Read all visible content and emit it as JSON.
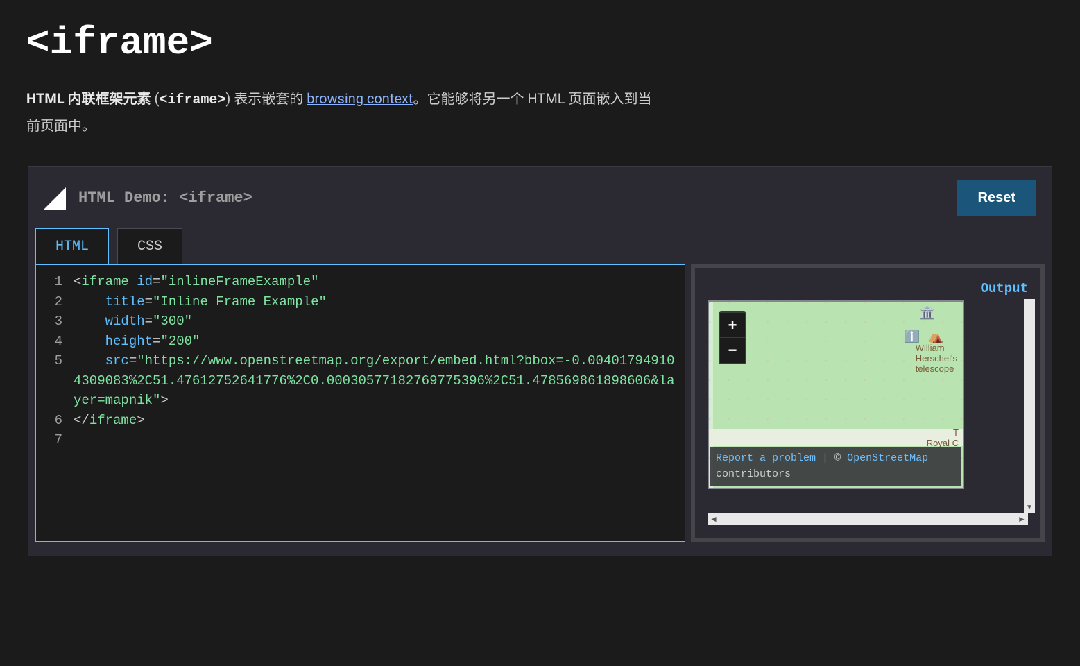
{
  "title": "<iframe>",
  "intro": {
    "lead_bold": "HTML 内联框架元素",
    "open_paren": " (",
    "code": "<iframe>",
    "close_paren": ") ",
    "text1": "表示嵌套的 ",
    "link_text": "browsing context",
    "text2": "。它能够将另一个 HTML 页面嵌入到当前页面中。"
  },
  "demo": {
    "title": "HTML Demo: <iframe>",
    "reset_label": "Reset",
    "tabs": {
      "html": "HTML",
      "css": "CSS"
    },
    "output_label": "Output"
  },
  "code_lines": [
    "1",
    "2",
    "3",
    "4",
    "5",
    "6",
    "7"
  ],
  "code": {
    "tag_open": "iframe",
    "attr_id": "id",
    "val_id": "\"inlineFrameExample\"",
    "attr_title": "title",
    "val_title": "\"Inline Frame Example\"",
    "attr_width": "width",
    "val_width": "\"300\"",
    "attr_height": "height",
    "val_height": "\"200\"",
    "attr_src": "src",
    "val_src": "\"https://www.openstreetmap.org/export/embed.html?bbox=-0.004017949104309083%2C51.47612752641776%2C0.00030577182769775396%2C51.478569861898606&layer=mapnik\"",
    "tag_close": "iframe"
  },
  "map": {
    "zoom_in": "+",
    "zoom_out": "−",
    "label_wh_1": "William",
    "label_wh_2": "Herschel's",
    "label_wh_3": "telescope",
    "label_royal_1": "T",
    "label_royal_2": "Royal C",
    "footer_report": "Report a problem",
    "footer_sep": " | ",
    "footer_copy": "© ",
    "footer_osm": "OpenStreetMap",
    "footer_contrib": "contributors"
  },
  "scroll": {
    "left": "◄",
    "right": "►",
    "down": "▼"
  }
}
